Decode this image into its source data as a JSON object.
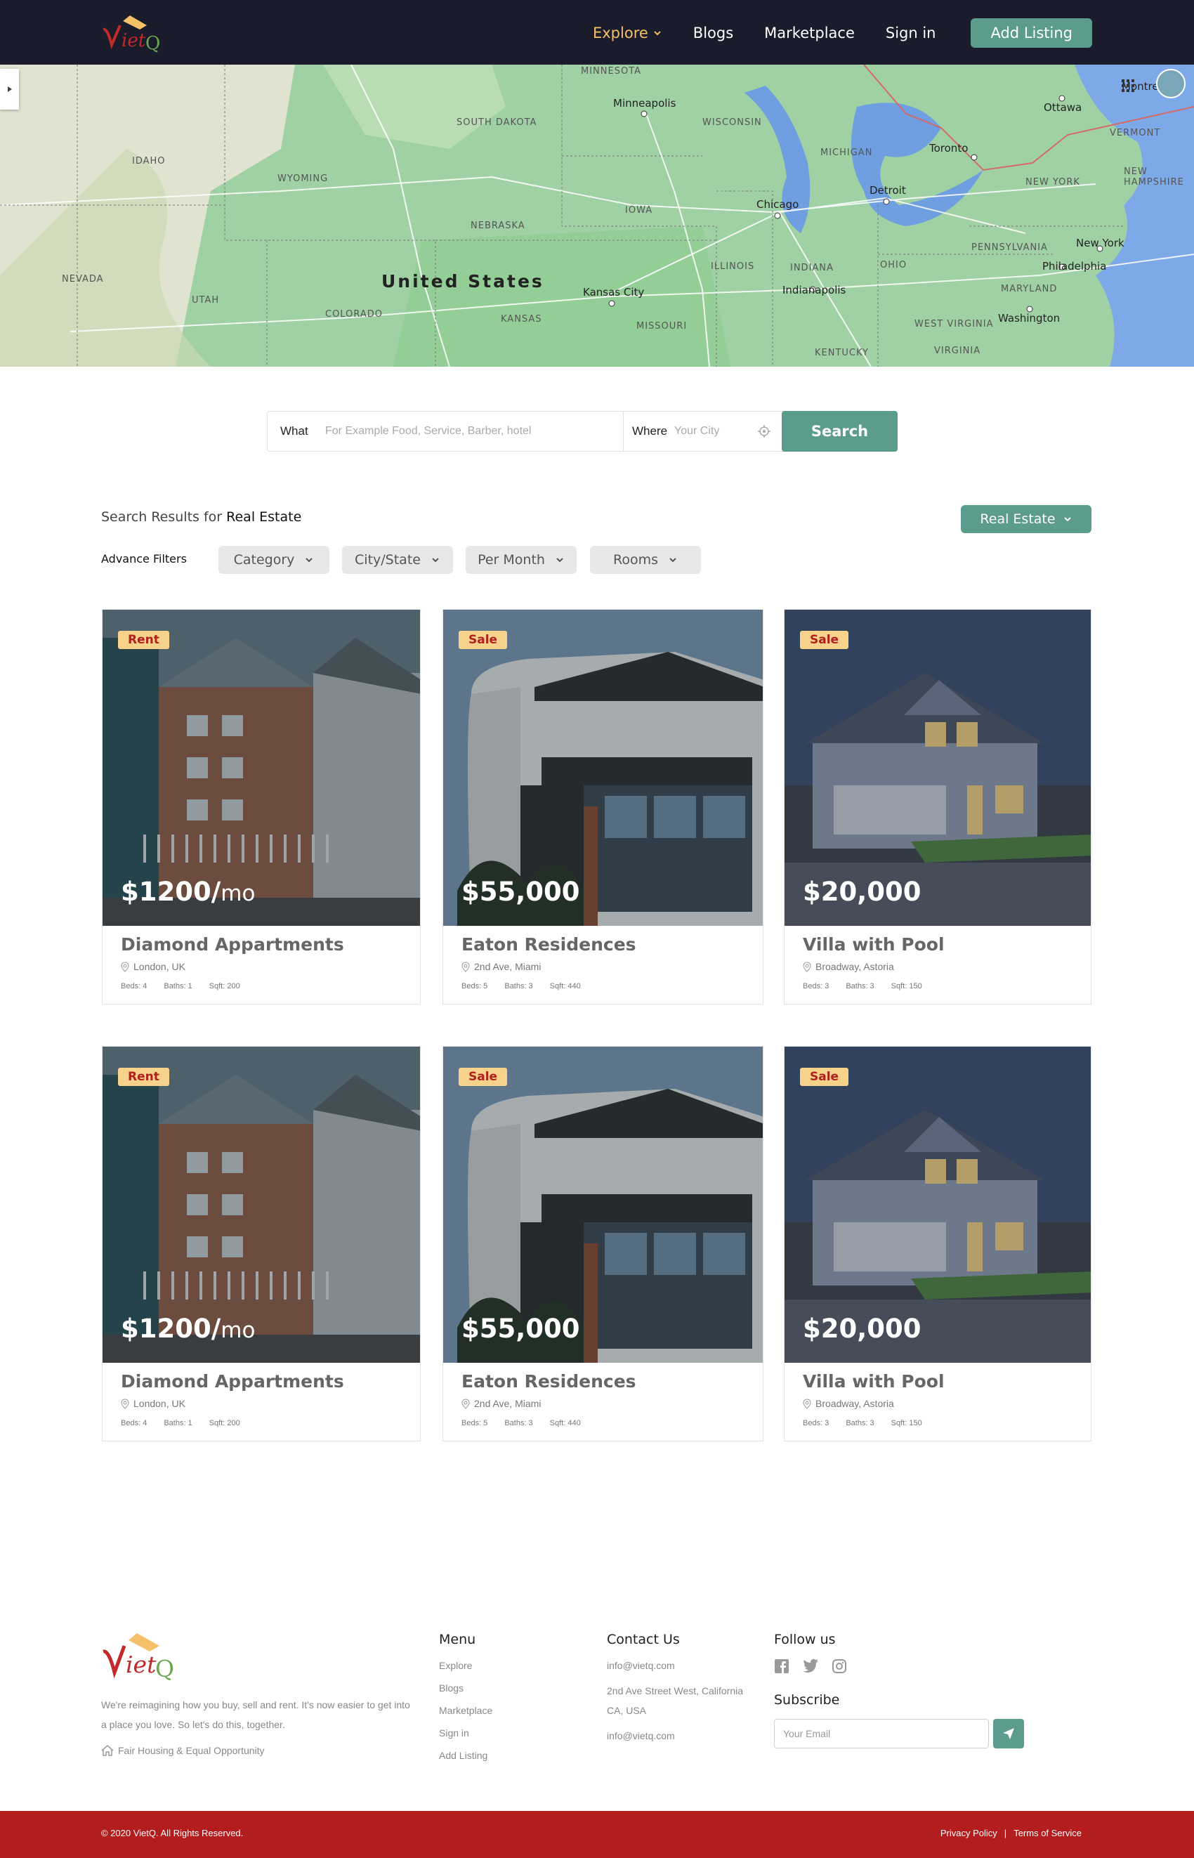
{
  "brand": {
    "logo_text": "VietQ"
  },
  "nav": {
    "explore": "Explore",
    "blogs": "Blogs",
    "marketplace": "Marketplace",
    "signin": "Sign in",
    "add_listing": "Add Listing"
  },
  "colors": {
    "header_bg": "#1b1c2b",
    "accent": "#5c9c8c",
    "active_nav": "#f4c168",
    "tag_bg": "#f7d28b",
    "tag_text": "#b0201c",
    "footer_bar": "#b41d1e"
  },
  "map": {
    "country": "United States",
    "states": [
      "MINNESOTA",
      "SOUTH DAKOTA",
      "WISCONSIN",
      "MICHIGAN",
      "IDAHO",
      "WYOMING",
      "IOWA",
      "NEBRASKA",
      "NEVADA",
      "UTAH",
      "COLORADO",
      "KANSAS",
      "MISSOURI",
      "ILLINOIS",
      "INDIANA",
      "OHIO",
      "PENNSYLVANIA",
      "NEW YORK",
      "VERMONT",
      "NEW HAMPSHIRE",
      "MARYLAND",
      "WEST VIRGINIA",
      "VIRGINIA",
      "KENTUCKY"
    ],
    "cities": [
      "Minneapolis",
      "Chicago",
      "Detroit",
      "Toronto",
      "Ottawa",
      "Montreal",
      "Kansas City",
      "Indianapolis",
      "New York",
      "Philadelphia",
      "Washington"
    ]
  },
  "search": {
    "what_label": "What",
    "what_placeholder": "For Example Food, Service, Barber, hotel",
    "where_label": "Where",
    "where_placeholder": "Your City",
    "button": "Search"
  },
  "results": {
    "prefix": "Search Results for",
    "query": "Real Estate",
    "category_button": "Real Estate",
    "advance_filters": "Advance Filters",
    "filters": [
      "Category",
      "City/State",
      "Per Month",
      "Rooms"
    ]
  },
  "listings": [
    {
      "tag": "Rent",
      "price": "$1200/",
      "unit": "mo",
      "name": "Diamond Appartments",
      "location": "London, UK",
      "beds": "Beds: 4",
      "baths": "Baths: 1",
      "sqft": "Sqft: 200"
    },
    {
      "tag": "Sale",
      "price": "$55,000",
      "unit": "",
      "name": "Eaton Residences",
      "location": "2nd Ave, Miami",
      "beds": "Beds: 5",
      "baths": "Baths: 3",
      "sqft": "Sqft: 440"
    },
    {
      "tag": "Sale",
      "price": "$20,000",
      "unit": "",
      "name": "Villa with Pool",
      "location": "Broadway, Astoria",
      "beds": "Beds: 3",
      "baths": "Baths: 3",
      "sqft": "Sqft: 150"
    },
    {
      "tag": "Rent",
      "price": "$1200/",
      "unit": "mo",
      "name": "Diamond Appartments",
      "location": "London, UK",
      "beds": "Beds: 4",
      "baths": "Baths: 1",
      "sqft": "Sqft: 200"
    },
    {
      "tag": "Sale",
      "price": "$55,000",
      "unit": "",
      "name": "Eaton Residences",
      "location": "2nd Ave, Miami",
      "beds": "Beds: 5",
      "baths": "Baths: 3",
      "sqft": "Sqft: 440"
    },
    {
      "tag": "Sale",
      "price": "$20,000",
      "unit": "",
      "name": "Villa with Pool",
      "location": "Broadway, Astoria",
      "beds": "Beds: 3",
      "baths": "Baths: 3",
      "sqft": "Sqft: 150"
    }
  ],
  "footer": {
    "description": "We're reimagining how you buy, sell and rent. It's now easier to get into a place you love. So let's do this, together.",
    "fair_housing": "Fair Housing & Equal Opportunity",
    "menu_title": "Menu",
    "menu": [
      "Explore",
      "Blogs",
      "Marketplace",
      "Sign in",
      "Add Listing"
    ],
    "contact_title": "Contact Us",
    "contact_email": "info@vietq.com",
    "contact_address": "2nd Ave Street West, California CA, USA",
    "contact_email2": "info@vietq.com",
    "follow_title": "Follow us",
    "subscribe_title": "Subscribe",
    "email_placeholder": "Your Email",
    "copyright": "© 2020 VietQ. All Rights Reserved.",
    "privacy": "Privacy Policy",
    "separator": "|",
    "terms": "Terms of Service"
  }
}
